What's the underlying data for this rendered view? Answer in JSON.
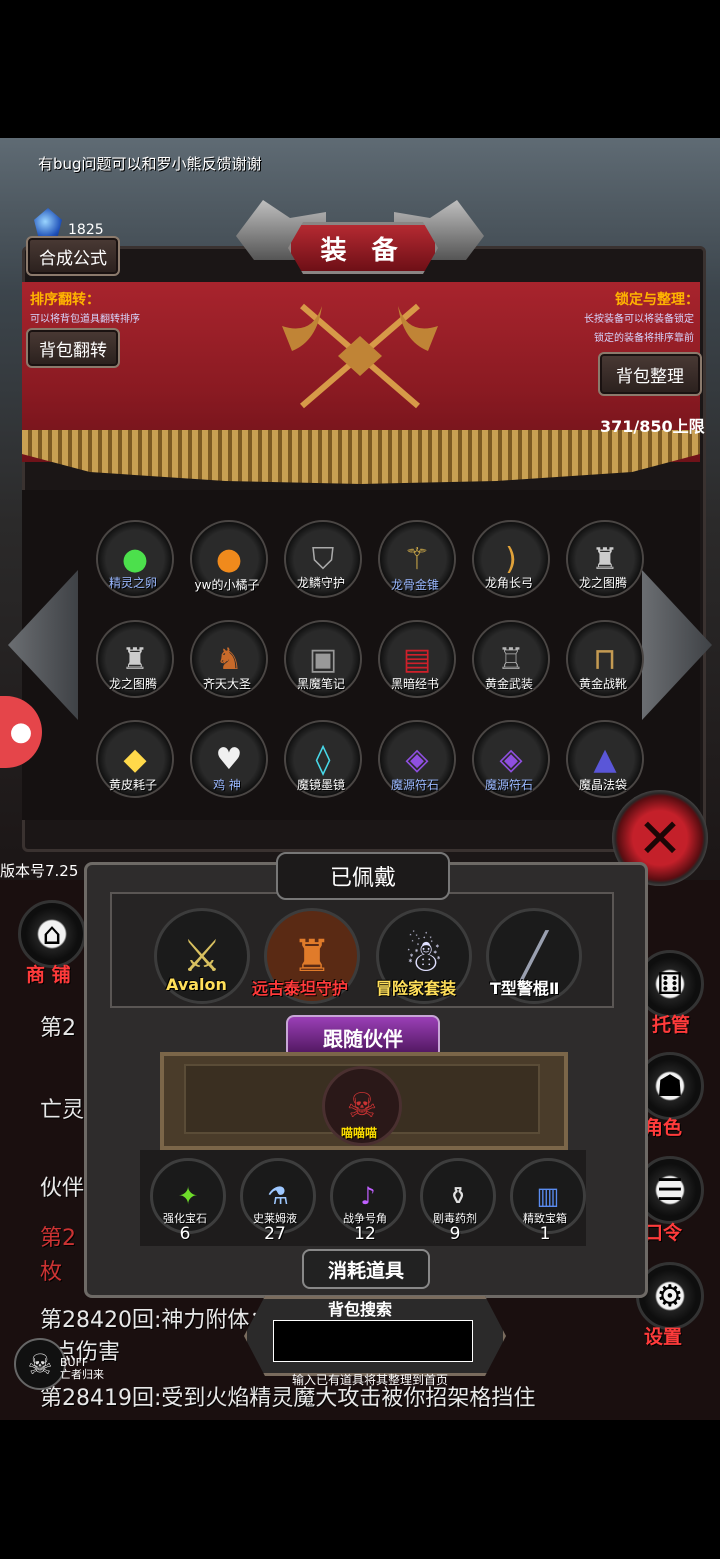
{
  "top_note": "有bug问题可以和罗小熊反馈谢谢",
  "gem_count": "1825",
  "title": "装 备",
  "buttons": {
    "recipe": "合成公式",
    "flip_bag": "背包翻转",
    "sort_bag": "背包整理"
  },
  "sort_flip": {
    "label": "排序翻转：",
    "note": "可以将背包道具翻转排序"
  },
  "lock_sort": {
    "label": "锁定与整理：",
    "note1": "长按装备可以将装备锁定",
    "note2": "锁定的装备将排序靠前"
  },
  "capacity": "371/850上限",
  "items": [
    {
      "label": "精灵之卵",
      "icon": "egg-icon",
      "color": "blue"
    },
    {
      "label": "yw的小橘子",
      "icon": "orange-icon",
      "color": "white"
    },
    {
      "label": "龙鳞守护",
      "icon": "shield-icon",
      "color": "white"
    },
    {
      "label": "龙骨金锥",
      "icon": "mace-icon",
      "color": "blue"
    },
    {
      "label": "龙角长弓",
      "icon": "bow-icon",
      "color": "white"
    },
    {
      "label": "龙之图腾",
      "icon": "totem-icon",
      "color": "white"
    },
    {
      "label": "龙之图腾",
      "icon": "totem-icon",
      "color": "white"
    },
    {
      "label": "齐天大圣",
      "icon": "monkey-icon",
      "color": "white"
    },
    {
      "label": "黑魔笔记",
      "icon": "book-icon",
      "color": "white"
    },
    {
      "label": "黑暗经书",
      "icon": "redbook-icon",
      "color": "white"
    },
    {
      "label": "黄金武装",
      "icon": "armor-icon",
      "color": "white"
    },
    {
      "label": "黄金战靴",
      "icon": "boots-icon",
      "color": "white"
    },
    {
      "label": "黄皮耗子",
      "icon": "mouse-icon",
      "color": "white"
    },
    {
      "label": "鸡 神",
      "icon": "chicken-icon",
      "color": "blue"
    },
    {
      "label": "魔镜墨镜",
      "icon": "mirror-icon",
      "color": "white"
    },
    {
      "label": "魔源符石",
      "icon": "rune-icon",
      "color": "blue"
    },
    {
      "label": "魔源符石",
      "icon": "rune-icon",
      "color": "blue"
    },
    {
      "label": "魔晶法袋",
      "icon": "wizard-icon",
      "color": "white"
    }
  ],
  "version": "版本号7.25",
  "worn": {
    "header": "已佩戴",
    "slots": [
      {
        "label": "Avalon",
        "icon": "sword-icon"
      },
      {
        "label": "远古泰坦守护",
        "icon": "titan-armor-icon"
      },
      {
        "label": "冒险家套装",
        "icon": "adventurer-icon"
      },
      {
        "label": "T型警棍Ⅱ",
        "icon": "baton-icon"
      }
    ]
  },
  "companion": {
    "header": "跟随伙伴",
    "name": "喵喵喵"
  },
  "consumables": {
    "header": "消耗道具",
    "items": [
      {
        "label": "强化宝石",
        "count": "6"
      },
      {
        "label": "史莱姆液",
        "count": "27"
      },
      {
        "label": "战争号角",
        "count": "12"
      },
      {
        "label": "剧毒药剂",
        "count": "9"
      },
      {
        "label": "精致宝箱",
        "count": "1"
      }
    ]
  },
  "search": {
    "title": "背包搜索",
    "value": "",
    "hint": "输入已有道具将其整理到首页"
  },
  "log": [
    "第2",
    "亡灵",
    "伙伴",
    "第2",
    "枚",
    "第28420回:神力附体：在对战精灵造成9444",
    "5点伤害",
    "第28419回:受到火焰精灵魔大攻击被你招架格挡住"
  ],
  "side_menu": [
    {
      "label": "商 铺",
      "icon": "shop-icon"
    },
    {
      "label": "托管",
      "icon": "dice-icon"
    },
    {
      "label": "角色",
      "icon": "hooded-figure-icon"
    },
    {
      "label": "口令",
      "icon": "scroll-icon"
    },
    {
      "label": "设置",
      "icon": "gear-icon"
    }
  ],
  "buff": {
    "label1": "BUFF",
    "label2": "亡者归来"
  }
}
